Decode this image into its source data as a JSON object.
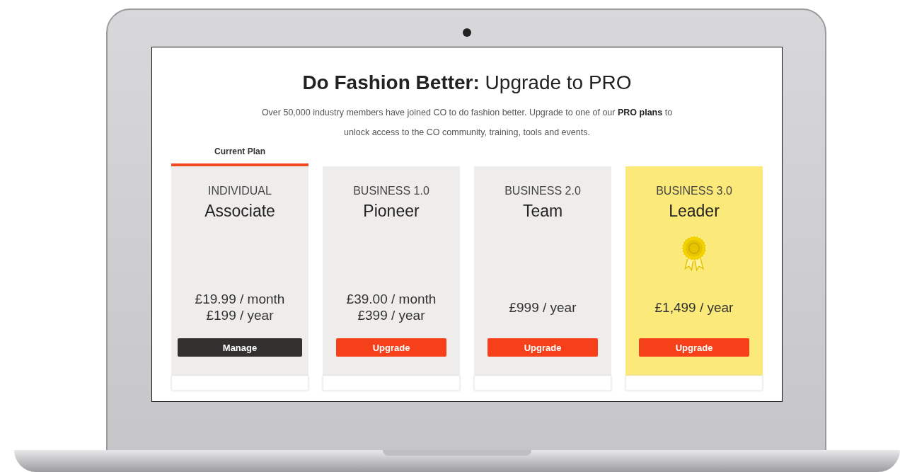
{
  "page": {
    "title_bold": "Do Fashion Better:",
    "title_rest": "Upgrade to PRO",
    "intro": "Over 50,000 industry members have joined CO to do fashion better. Upgrade to one of our **PRO plans** to unlock access to the CO community, training, tools and events.",
    "current_label": "Current Plan"
  },
  "plans": [
    {
      "tier": "INDIVIDUAL",
      "name": "Associate",
      "prices": [
        "£19.99 / month",
        "£199 / year"
      ],
      "button": "Manage",
      "current": true,
      "highlighted": false,
      "badge": false
    },
    {
      "tier": "BUSINESS 1.0",
      "name": "Pioneer",
      "prices": [
        "£39.00 / month",
        "£399 / year"
      ],
      "button": "Upgrade",
      "current": false,
      "highlighted": false,
      "badge": false
    },
    {
      "tier": "BUSINESS 2.0",
      "name": "Team",
      "prices": [
        "£999 / year"
      ],
      "button": "Upgrade",
      "current": false,
      "highlighted": false,
      "badge": false
    },
    {
      "tier": "BUSINESS 3.0",
      "name": "Leader",
      "prices": [
        "£1,499 / year"
      ],
      "button": "Upgrade",
      "current": false,
      "highlighted": true,
      "badge": true
    }
  ]
}
